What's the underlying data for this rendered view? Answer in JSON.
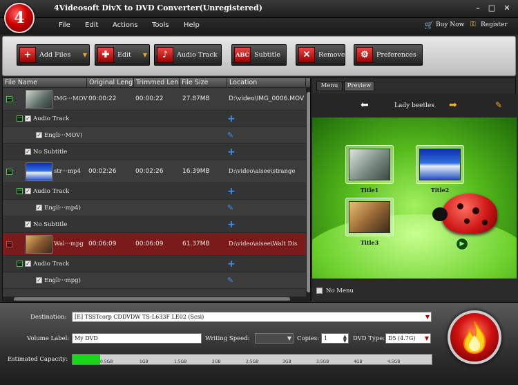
{
  "window": {
    "title": "4Videosoft DivX to DVD Converter(Unregistered)",
    "logo_glyph": "4",
    "min_glyph": "–",
    "max_glyph": "□",
    "close_glyph": "✕"
  },
  "menu": [
    "File",
    "Edit",
    "Actions",
    "Tools",
    "Help"
  ],
  "links": {
    "buy": "Buy Now",
    "register": "Register"
  },
  "toolbar": {
    "add_files": "Add Files",
    "edit": "Edit",
    "audio_track": "Audio Track",
    "subtitle": "Subtitle",
    "remove": "Remove",
    "preferences": "Preferences"
  },
  "columns": [
    "File Name",
    "Original Length",
    "Trimmed Length",
    "File Size",
    "Location"
  ],
  "files": [
    {
      "name": "IMG···MOV",
      "original": "00:00:22",
      "trimmed": "00:00:22",
      "size": "27.87MB",
      "location": "D:\\video\\IMG_0006.MOV",
      "audio_label": "Audio Track",
      "audio_item": "Engli···MOV)",
      "subtitle": "No Subtitle"
    },
    {
      "name": "str···mp4",
      "original": "00:02:26",
      "trimmed": "00:02:26",
      "size": "16.39MB",
      "location": "D:\\video\\aisee\\strange",
      "audio_label": "Audio Track",
      "audio_item": "Engli···mp4)",
      "subtitle": "No Subtitle"
    },
    {
      "name": "Wal···mpg",
      "original": "00:06:09",
      "trimmed": "00:06:09",
      "size": "61.37MB",
      "location": "D:\\video\\aisee\\Walt Dis",
      "audio_label": "Audio Track",
      "audio_item": "Engli···mpg)"
    }
  ],
  "preview": {
    "tab_menu": "Menu",
    "tab_preview": "Preview",
    "menu_title": "Lady beetles",
    "titles": [
      "Title1",
      "Title2",
      "Title3"
    ],
    "no_menu": "No Menu"
  },
  "bottom": {
    "destination_label": "Destination:",
    "destination_value": "[E] TSSTcorp CDDVDW TS-L633F LE02 (Scsi)",
    "volume_label": "Volume Label:",
    "volume_value": "My DVD",
    "writing_speed_label": "Writing Speed:",
    "writing_speed_value": "",
    "copies_label": "Copies:",
    "copies_value": "1",
    "dvd_type_label": "DVD Type:",
    "dvd_type_value": "D5 (4.7G)",
    "capacity_label": "Estimated Capacity:",
    "capacity_ticks": [
      "0.5GB",
      "1GB",
      "1.5GB",
      "2GB",
      "2.5GB",
      "3GB",
      "3.5GB",
      "4GB",
      "4.5GB"
    ],
    "capacity_fill_fraction": 0.076
  },
  "colors": {
    "accent": "#c00000",
    "selected_row": "#7a1a1a",
    "capacity": "#1cd41c",
    "link_icon": "#3399ff"
  }
}
